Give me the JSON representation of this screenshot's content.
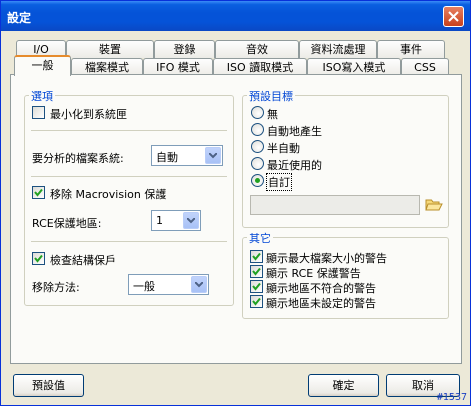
{
  "window": {
    "title": "設定"
  },
  "tabs": {
    "row_back": [
      "I/O",
      "裝置",
      "登錄",
      "音效",
      "資料流處理",
      "事件"
    ],
    "row_front": [
      "一般",
      "檔案模式",
      "IFO 模式",
      "ISO 讀取模式",
      "ISO寫入模式",
      "CSS"
    ],
    "active": "一般"
  },
  "options_group": {
    "title": "選項",
    "minimize_to_tray": {
      "label": "最小化到系統匣",
      "checked": false
    },
    "filesystem": {
      "label": "要分析的檔案系統:",
      "value": "自動"
    },
    "remove_macrovision": {
      "label": "移除 Macrovision 保護",
      "checked": true
    },
    "rce_region": {
      "label": "RCE保護地區:",
      "value": "1"
    },
    "check_protection": {
      "label": "檢查結構保戶",
      "checked": true
    },
    "removal_method": {
      "label": "移除方法:",
      "value": "一般"
    }
  },
  "default_target_group": {
    "title": "預設目標",
    "options": [
      "無",
      "自動地產生",
      "半自動",
      "最近使用的",
      "自訂"
    ],
    "selected": "自訂",
    "path": ""
  },
  "other_group": {
    "title": "其它",
    "items": [
      {
        "label": "顯示最大檔案大小的警告",
        "checked": true
      },
      {
        "label": "顯示 RCE 保護警告",
        "checked": true
      },
      {
        "label": "顯示地區不符合的警告",
        "checked": true
      },
      {
        "label": "顯示地區未設定的警告",
        "checked": true
      }
    ]
  },
  "buttons": {
    "defaults": "預設值",
    "ok": "確定",
    "cancel": "取消"
  },
  "watermark": "#1537",
  "colors": {
    "titlebar": "#0553d8",
    "group_title": "#0046d5",
    "active_tab_accent": "#e68b2c",
    "check_mark": "#21a121"
  }
}
